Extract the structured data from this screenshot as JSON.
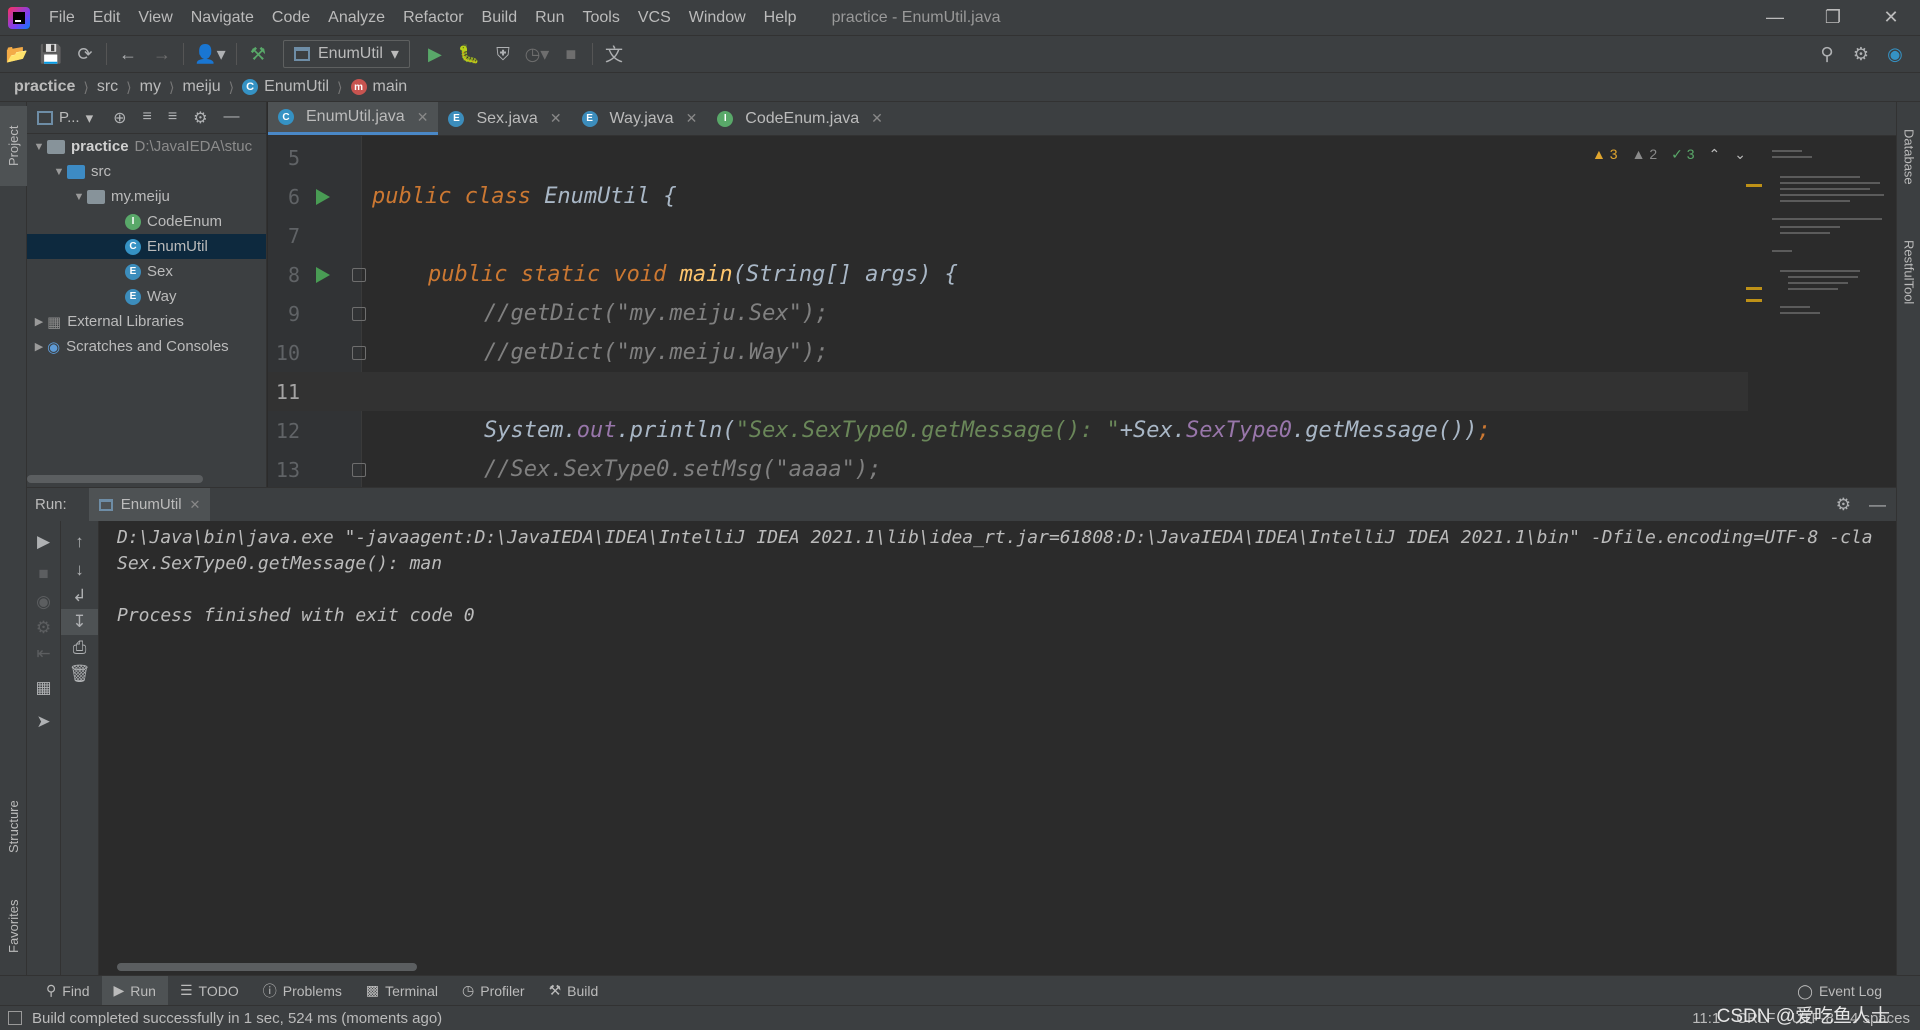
{
  "menubar": {
    "items": [
      "File",
      "Edit",
      "View",
      "Navigate",
      "Code",
      "Analyze",
      "Refactor",
      "Build",
      "Run",
      "Tools",
      "VCS",
      "Window",
      "Help"
    ],
    "title": "practice - EnumUtil.java"
  },
  "toolbar": {
    "run_config": "EnumUtil"
  },
  "breadcrumb": {
    "items": [
      "practice",
      "src",
      "my",
      "meiju",
      "EnumUtil",
      "main"
    ]
  },
  "project": {
    "header_label": "P...",
    "tree": [
      {
        "label": "practice",
        "path": "D:\\JavaIEDA\\stuc"
      },
      {
        "label": "src"
      },
      {
        "label": "my.meiju"
      },
      {
        "label": "CodeEnum"
      },
      {
        "label": "EnumUtil"
      },
      {
        "label": "Sex"
      },
      {
        "label": "Way"
      },
      {
        "label": "External Libraries"
      },
      {
        "label": "Scratches and Consoles"
      }
    ]
  },
  "left_stripe": {
    "project": "Project",
    "structure": "Structure",
    "favorites": "Favorites"
  },
  "right_stripe": {
    "database": "Database",
    "restful": "RestfulTool"
  },
  "tabs": [
    {
      "label": "EnumUtil.java",
      "icon": "C",
      "active": true
    },
    {
      "label": "Sex.java",
      "icon": "E"
    },
    {
      "label": "Way.java",
      "icon": "E"
    },
    {
      "label": "CodeEnum.java",
      "icon": "I"
    }
  ],
  "editor": {
    "line_numbers": [
      "5",
      "6",
      "7",
      "8",
      "9",
      "10",
      "11",
      "12",
      "13"
    ],
    "inspections": {
      "warnings": "3",
      "weak_warnings": "2",
      "ok": "3"
    },
    "code": {
      "l6_kw": "public class ",
      "l6_name": "EnumUtil",
      "l6_rest": " {",
      "l8_kw": "public static void ",
      "l8_fn": "main",
      "l8_rest": "(String[] args) {",
      "l9": "//getDict(\"my.meiju.Sex\");",
      "l10": "//getDict(\"my.meiju.Way\");",
      "l12_a": "System.",
      "l12_out": "out",
      "l12_b": ".println(",
      "l12_str": "\"Sex.SexType0.getMessage(): \"",
      "l12_c": "+Sex.",
      "l12_fld": "SexType0",
      "l12_d": ".getMessage())",
      "l12_semi": ";",
      "l13": "//Sex.SexType0.setMsg(\"aaaa\");"
    }
  },
  "run": {
    "label": "Run:",
    "tab": "EnumUtil",
    "console": [
      "D:\\Java\\bin\\java.exe \"-javaagent:D:\\JavaIEDA\\IDEA\\IntelliJ IDEA 2021.1\\lib\\idea_rt.jar=61808:D:\\JavaIEDA\\IDEA\\IntelliJ IDEA 2021.1\\bin\" -Dfile.encoding=UTF-8 -cla",
      "Sex.SexType0.getMessage(): man",
      "",
      "Process finished with exit code 0"
    ]
  },
  "tool_tabs": [
    "Find",
    "Run",
    "TODO",
    "Problems",
    "Terminal",
    "Profiler",
    "Build"
  ],
  "event_log": "Event Log",
  "status": {
    "message": "Build completed successfully in 1 sec, 524 ms (moments ago)",
    "position": "11:1",
    "line_sep": "CRLF",
    "encoding": "UTF-8",
    "indent": "4 spaces",
    "watermark": "CSDN @爱吃鱼人士"
  },
  "colors": {
    "keyword": "#cc7832",
    "function": "#ffc66d",
    "string": "#6a8759",
    "comment": "#808080",
    "field": "#9876aa",
    "accent": "#4a88c7"
  }
}
